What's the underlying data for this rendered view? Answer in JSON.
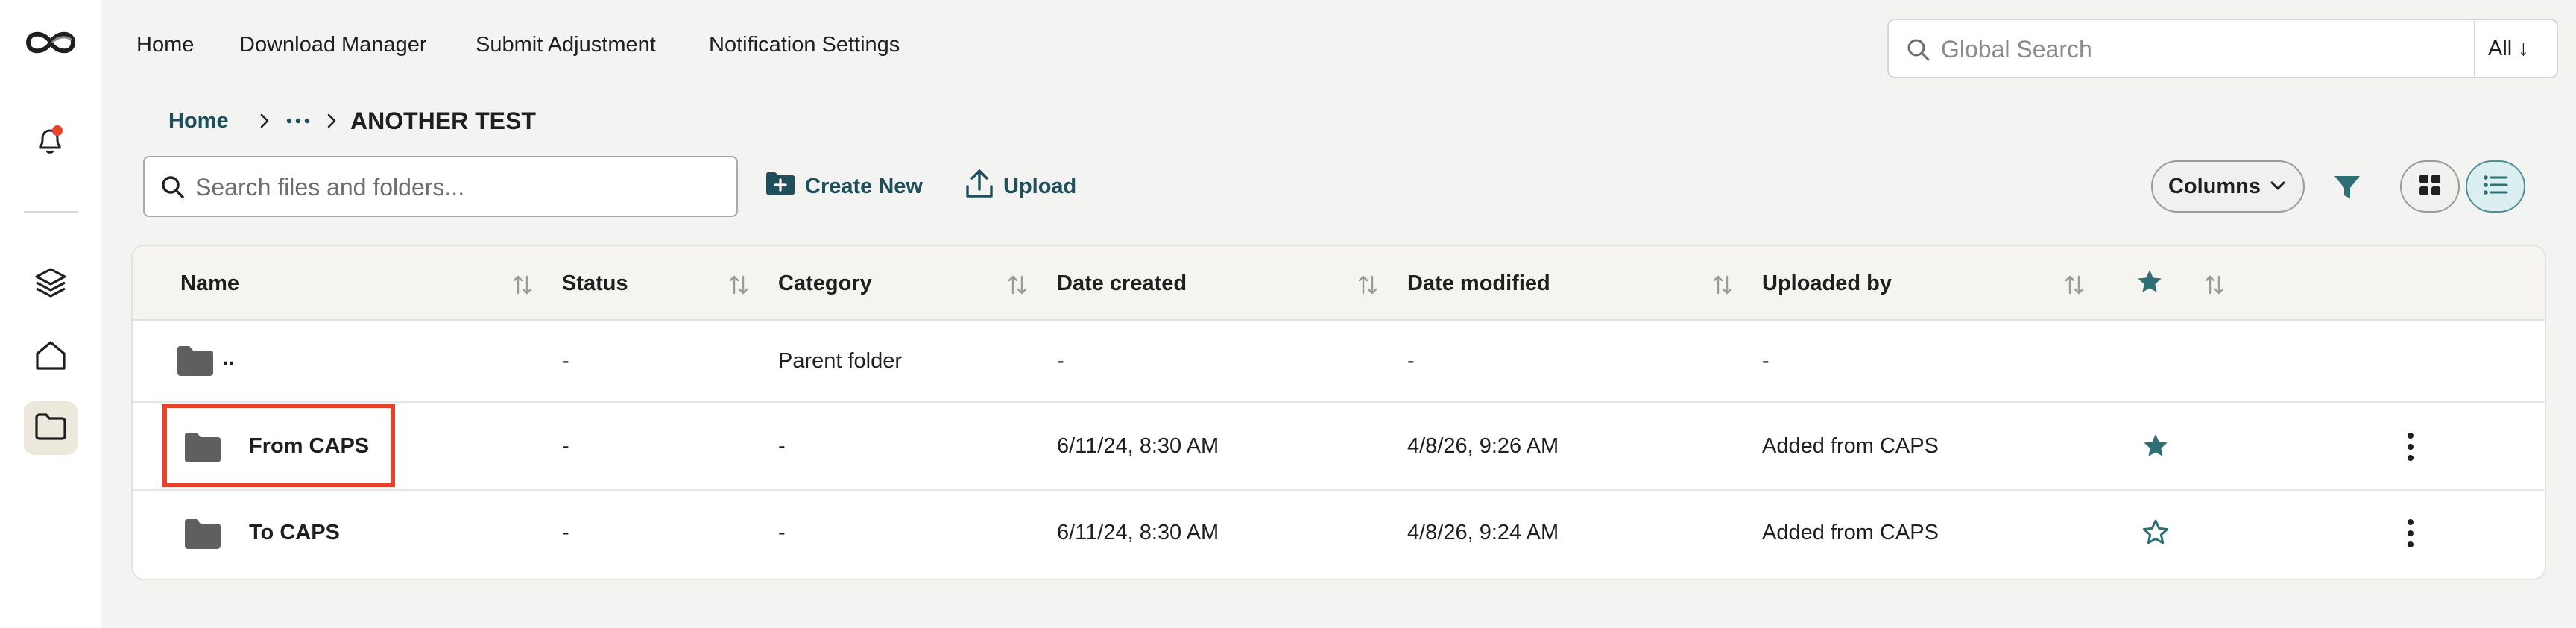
{
  "nav": {
    "items": [
      "Home",
      "Download Manager",
      "Submit Adjustment",
      "Notification Settings"
    ]
  },
  "global_search": {
    "placeholder": "Global Search",
    "scope": "All ↓"
  },
  "breadcrumb": {
    "home": "Home",
    "current": "ANOTHER TEST"
  },
  "toolbar": {
    "search_placeholder": "Search files and folders...",
    "create_new": "Create New",
    "upload": "Upload",
    "columns": "Columns"
  },
  "table": {
    "headers": {
      "name": "Name",
      "status": "Status",
      "category": "Category",
      "date_created": "Date created",
      "date_modified": "Date modified",
      "uploaded_by": "Uploaded by"
    },
    "rows": [
      {
        "name": "..",
        "status": "-",
        "category": "Parent folder",
        "date_created": "-",
        "date_modified": "-",
        "uploaded_by": "-",
        "starred": null
      },
      {
        "name": "From CAPS",
        "status": "-",
        "category": "-",
        "date_created": "6/11/24, 8:30 AM",
        "date_modified": "4/8/26, 9:26 AM",
        "uploaded_by": "Added from CAPS",
        "starred": true
      },
      {
        "name": "To CAPS",
        "status": "-",
        "category": "-",
        "date_created": "6/11/24, 8:30 AM",
        "date_modified": "4/8/26, 9:24 AM",
        "uploaded_by": "Added from CAPS",
        "starred": false
      }
    ]
  },
  "colors": {
    "accent": "#2f6f74",
    "link": "#1f4f5a",
    "highlight": "#e8412c",
    "notification_dot": "#e8412c"
  },
  "icons": [
    "logo-icon",
    "bell-icon",
    "layers-icon",
    "home-icon",
    "folder-icon",
    "search-icon",
    "plus-folder-icon",
    "upload-icon",
    "chevron-down-icon",
    "filter-icon",
    "grid-view-icon",
    "list-view-icon",
    "sort-icon",
    "star-icon",
    "kebab-icon"
  ]
}
